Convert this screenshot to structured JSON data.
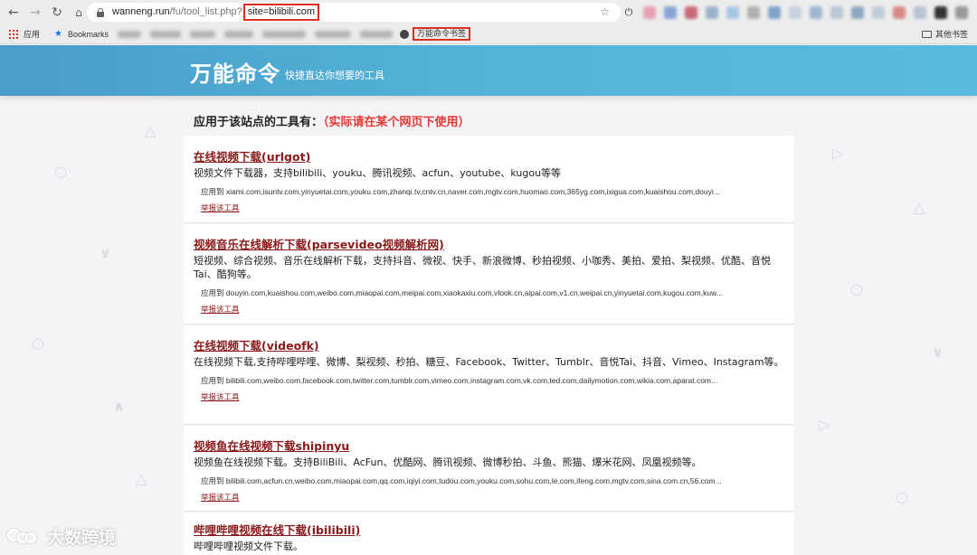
{
  "browser": {
    "url_host": "wanneng.run",
    "url_path": "/fu/tool_list.php?",
    "url_query": "site=bilibili.com",
    "bookmarks_apps": "应用",
    "bookmarks_label": "Bookmarks",
    "bookmark_highlight": "万能命令书签",
    "other_bookmarks": "其他书签"
  },
  "site": {
    "title": "万能命令",
    "subtitle": "快捷直达你想要的工具"
  },
  "intro": {
    "text": "应用于该站点的工具有：",
    "note": "（实际请在某个网页下使用）"
  },
  "tools": [
    {
      "title": "在线视频下载(urlgot)",
      "desc": "视频文件下载器，支持bilibili、youku、腾讯视频、acfun、youtube、kugou等等",
      "apply": "应用到  xiami.com,isuntv.com,yinyuetai.com,youku.com,zhanqi.tv,cntv.cn,naver.com,mgtv.com,huomao.com,365yg.com,ixigua.com,kuaishou.com,douyi...",
      "report": "举报该工具"
    },
    {
      "title": "视频音乐在线解析下载(parsevideo视频解析网)",
      "desc": "短视频、综合视频、音乐在线解析下载，支持抖音、微视、快手、新浪微博、秒拍视频、小咖秀、美拍、爱拍、梨视频、优酷、音悦Tai、酷狗等。",
      "apply": "应用到  douyin.com,kuaishou.com,weibo.com,miaopai.com,meipai.com,xiaokaxiu.com,vlook.cn,aipai.com,v1.cn,weipai.cn,yinyuetai.com,kugou.com,kuw...",
      "report": "举报该工具"
    },
    {
      "title": "在线视频下载(videofk)",
      "desc": "在线视频下载,支持哔哩哔哩、微博、梨视频、秒拍、糖豆、Facebook、Twitter、Tumblr、音悦Tai、抖音、Vimeo、Instagram等。",
      "apply": "应用到  bilibili.com,weibo.com,facebook.com,twitter.com,tumblr.com,vimeo.com,instagram.com,vk.com,ted.com,dailymotion.com,wikia.com,aparat.com...",
      "report": "举报该工具"
    },
    {
      "title": "视频鱼在线视频下载shipinyu",
      "desc": "视频鱼在线视频下载。支持BiliBili、AcFun、优酷网、腾讯视频、微博秒拍、斗鱼、熊猫、爆米花网、凤凰视频等。",
      "apply": "应用到  bilibili.com,acfun.cn,weibo.com,miaopai.com,qq.com,iqiyi.com,tudou.com,youku.com,sohu.com,le.com,ifeng.com,mgtv.com,sina.com.cn,56.com...",
      "report": "举报该工具"
    },
    {
      "title": "哔哩哔哩视频在线下载(ibilibili)",
      "desc": "哔哩哔哩视频文件下载。"
    }
  ],
  "watermark": "大数跨境",
  "colors": {
    "banner": "#52b4d8",
    "title_link": "#8a1a1a",
    "intro_note": "#e53935",
    "highlight_box": "#d93025"
  }
}
